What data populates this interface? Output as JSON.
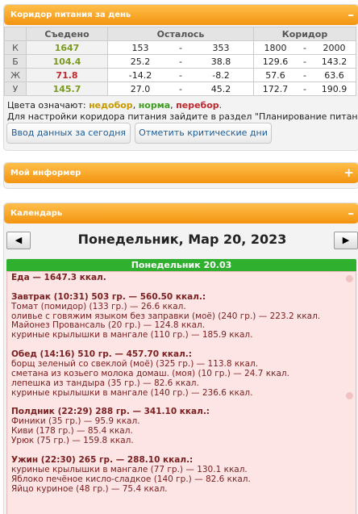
{
  "corridor": {
    "title": "Коридор питания за день",
    "collapse_icon": "minus-icon",
    "columns": [
      "Съедено",
      "Осталось",
      "Коридор"
    ],
    "rows": [
      {
        "label": "К",
        "eaten": "1647",
        "eaten_color": "#7a9a1f",
        "ost_min": "153",
        "ost_max": "353",
        "kor_min": "1800",
        "kor_max": "2000"
      },
      {
        "label": "Б",
        "eaten": "104.4",
        "eaten_color": "#7a9a1f",
        "ost_min": "25.2",
        "ost_max": "38.8",
        "kor_min": "129.6",
        "kor_max": "143.2"
      },
      {
        "label": "Ж",
        "eaten": "71.8",
        "eaten_color": "#c0282f",
        "ost_min": "-14.2",
        "ost_max": "-8.2",
        "kor_min": "57.6",
        "kor_max": "63.6"
      },
      {
        "label": "У",
        "eaten": "145.7",
        "eaten_color": "#7a9a1f",
        "ost_min": "27.0",
        "ost_max": "45.2",
        "kor_min": "172.7",
        "kor_max": "190.9"
      }
    ],
    "dash": "-",
    "legend_prefix": "Цвета означают: ",
    "legend_under": "недобор",
    "legend_norm": "норма",
    "legend_over": "перебор",
    "comma": ", ",
    "period": ".",
    "settings_note": "Для настройки коридора питания зайдите в раздел \"Планирование питания\".",
    "btn_today": "Ввод данных за сегодня",
    "btn_critical": "Отметить критические дни",
    "colors": {
      "under": "#c79a00",
      "norm": "#3f9c22",
      "over": "#c0282f"
    }
  },
  "informer": {
    "title": "Мой информер",
    "expand_icon": "plus-icon"
  },
  "calendar": {
    "title": "Календарь",
    "collapse_icon": "minus-icon",
    "prev_icon": "triangle-left-icon",
    "next_icon": "triangle-right-icon",
    "date_title": "Понедельник, Мар 20, 2023",
    "day_header": "Понедельник 20.03",
    "lines": [
      {
        "text": "Еда — 1647.3 ккал.",
        "kind": "total"
      },
      {
        "text": "",
        "kind": "blank"
      },
      {
        "text": "Завтрак (10:31) 503 гр. — 560.50 ккал.:",
        "kind": "meal"
      },
      {
        "text": "Томат (помидор) (133 гр.) — 26.6 ккал.",
        "kind": "item"
      },
      {
        "text": "оливье с говяжим языком без заправки (моё) (240 гр.) — 223.2 ккал.",
        "kind": "item"
      },
      {
        "text": "Майонез Провансаль (20 гр.) — 124.8 ккал.",
        "kind": "item"
      },
      {
        "text": "куриные крылышки в мангале (110 гр.) — 185.9 ккал.",
        "kind": "item"
      },
      {
        "text": "",
        "kind": "blank"
      },
      {
        "text": "Обед (14:16) 510 гр. — 457.70 ккал.:",
        "kind": "meal"
      },
      {
        "text": "борщ зеленый со свеклой (моё) (325 гр.) — 113.8 ккал.",
        "kind": "item"
      },
      {
        "text": "сметана из козьего молока домаш. (моя) (10 гр.) — 24.7 ккал.",
        "kind": "item"
      },
      {
        "text": "лепешка из тандыра (35 гр.) — 82.6 ккал.",
        "kind": "item"
      },
      {
        "text": "куриные крылышки в мангале (140 гр.) — 236.6 ккал.",
        "kind": "item"
      },
      {
        "text": "",
        "kind": "blank"
      },
      {
        "text": "Полдник (22:29) 288 гр. — 341.10 ккал.:",
        "kind": "meal"
      },
      {
        "text": "Финики (35 гр.) — 95.9 ккал.",
        "kind": "item"
      },
      {
        "text": "Киви (178 гр.) — 85.4 ккал.",
        "kind": "item"
      },
      {
        "text": "Урюк (75 гр.) — 159.8 ккал.",
        "kind": "item"
      },
      {
        "text": "",
        "kind": "blank"
      },
      {
        "text": "Ужин (22:30) 265 гр. — 288.10 ккал.:",
        "kind": "meal"
      },
      {
        "text": "куриные крылышки в мангале (77 гр.) — 130.1 ккал.",
        "kind": "item"
      },
      {
        "text": "Яблоко печёное кисло-сладкое (140 гр.) — 82.6 ккал.",
        "kind": "item"
      },
      {
        "text": "Яйцо куриное (48 гр.) — 75.4 ккал.",
        "kind": "item"
      }
    ]
  }
}
